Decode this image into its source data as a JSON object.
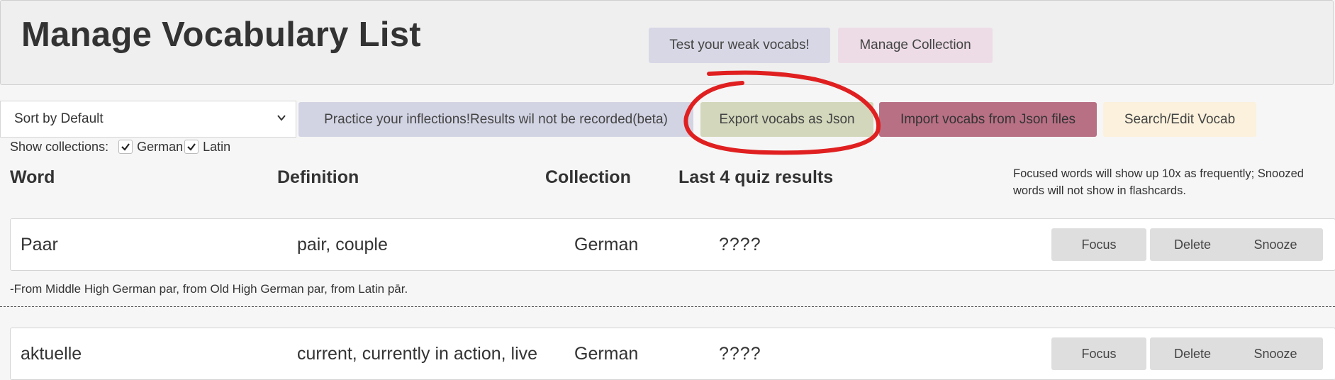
{
  "header": {
    "title": "Manage Vocabulary List",
    "test_button": "Test your weak vocabs!",
    "manage_button": "Manage Collection"
  },
  "toolbar": {
    "sort_value": "Sort by Default",
    "practice_button": "Practice your inflections!Results wil not be recorded(beta)",
    "export_button": "Export vocabs as Json",
    "import_button": "Import vocabs from Json files",
    "search_button": "Search/Edit Vocab"
  },
  "filters": {
    "label": "Show collections:",
    "collections": [
      {
        "name": "German",
        "checked": true
      },
      {
        "name": "Latin",
        "checked": true
      }
    ]
  },
  "table": {
    "headers": [
      "Word",
      "Definition",
      "Collection",
      "Last 4 quiz results"
    ],
    "note": "Focused words will show up 10x as frequently; Snoozed words will not show in flashcards.",
    "rows": [
      {
        "word": "Paar",
        "definition": "pair, couple",
        "collection": "German",
        "quiz": "????",
        "etymology": "-From Middle High German par, from Old High German par, from Latin pār.",
        "buttons": {
          "focus": "Focus",
          "delete": "Delete",
          "snooze": "Snooze"
        }
      },
      {
        "word": "aktuelle",
        "definition": "current, currently in action, live",
        "collection": "German",
        "quiz": "????",
        "buttons": {
          "focus": "Focus",
          "delete": "Delete",
          "snooze": "Snooze"
        }
      }
    ]
  },
  "colors": {
    "annotation": "#e02020"
  }
}
